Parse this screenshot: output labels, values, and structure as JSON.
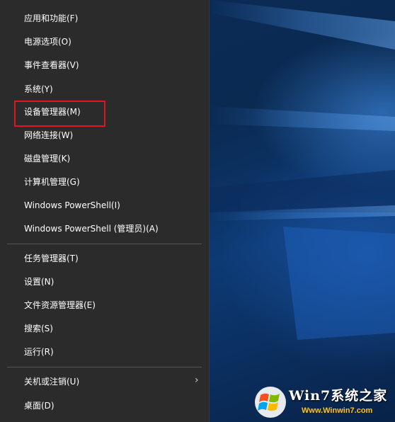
{
  "menu": {
    "items": [
      {
        "label": "应用和功能(F)"
      },
      {
        "label": "电源选项(O)"
      },
      {
        "label": "事件查看器(V)"
      },
      {
        "label": "系统(Y)"
      },
      {
        "label": "设备管理器(M)"
      },
      {
        "label": "网络连接(W)"
      },
      {
        "label": "磁盘管理(K)"
      },
      {
        "label": "计算机管理(G)"
      },
      {
        "label": "Windows PowerShell(I)"
      },
      {
        "label": "Windows PowerShell (管理员)(A)"
      },
      {
        "label": "任务管理器(T)"
      },
      {
        "label": "设置(N)"
      },
      {
        "label": "文件资源管理器(E)"
      },
      {
        "label": "搜索(S)"
      },
      {
        "label": "运行(R)"
      },
      {
        "label": "关机或注销(U)"
      },
      {
        "label": "桌面(D)"
      }
    ],
    "highlighted_item": "设备管理器(M)",
    "highlight_color": "#e0161e",
    "background_color": "#2b2b2b"
  },
  "watermark": {
    "main_text": "Win7系统之家",
    "sub_text": "Www.Winwin7.com"
  }
}
